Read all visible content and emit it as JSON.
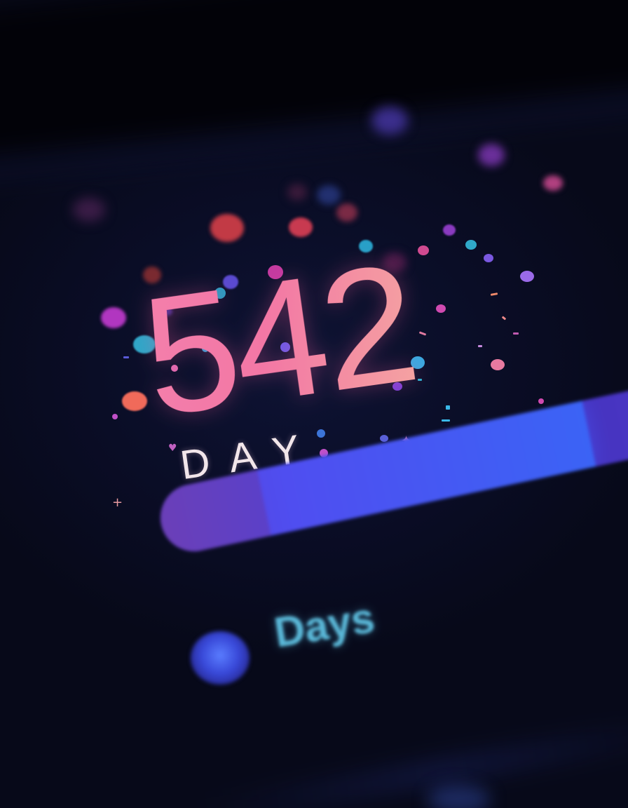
{
  "counter": {
    "value": "542",
    "unit": "DAY"
  },
  "progress": {
    "fill_fraction": 0.8,
    "track_color": "#3a2c9a",
    "fill_color": "#4f4ef0"
  },
  "legend": {
    "label": "Days",
    "marker_color": "#3848d8"
  },
  "colors": {
    "background": "#0a0d26",
    "number": "#f0709f",
    "unit_text": "#f2e6ea",
    "legend_text": "#5ab8d8"
  }
}
